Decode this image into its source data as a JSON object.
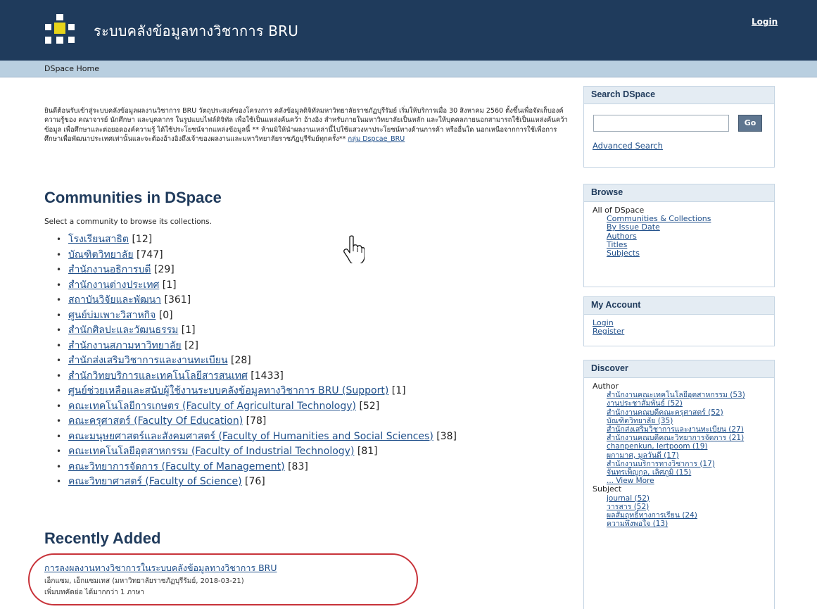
{
  "header": {
    "site_title": "ระบบคลังข้อมูลทางวิชาการ BRU",
    "login_label": "Login"
  },
  "breadcrumb": {
    "home": "DSpace Home"
  },
  "intro": {
    "text": "ยินดีต้อนรับเข้าสู่ระบบคลังข้อมูลผลงานวิชาการ BRU วัตถุประสงค์ของโครงการ คลังข้อมูลดิจิทัลมหาวิทยาลัยราชภัฏบุรีรัมย์ เริ่มให้บริการเมื่อ 30 สิงหาคม 2560 ตั้งขึ้นเพื่อจัดเก็บองค์ความรู้ของ คณาจารย์ นักศึกษา และบุคลากร ในรูปแบบไฟล์ดิจิทัล เพื่อใช้เป็นแหล่งค้นคว้า อ้างอิง สำหรับภายในมหาวิทยาลัยเป็นหลัก และให้บุคคลภายนอกสามารถใช้เป็นแหล่งค้นคว้าข้อมูล เพื่อศึกษาและต่อยอดองค์ความรู้ ได้ใช้ประโยชน์จากแหล่งข้อมูลนี้ ** ห้ามมิให้นำผลงานเหล่านี้ไปใช้แสวงหาประโยชน์ทางด้านการค้า หรืออื่นใด นอกเหนือจากการใช้เพื่อการศึกษาเพื่อพัฒนาประเทศเท่านั้นและจะต้องอ้างอิงถึงเจ้าของผลงานและมหาวิทยาลัยราชภัฏบุรีรัมย์ทุกครั้ง** ",
    "link": "กลุ่ม Dspcae_BRU"
  },
  "communities": {
    "heading": "Communities in DSpace",
    "hint": "Select a community to browse its collections.",
    "items": [
      {
        "name": "โรงเรียนสาธิต",
        "count": "[12]"
      },
      {
        "name": "บัณฑิตวิทยาลัย",
        "count": "[747]"
      },
      {
        "name": "สำนักงานอธิการบดี",
        "count": "[29]"
      },
      {
        "name": "สำนักงานต่างประเทศ",
        "count": "[1]"
      },
      {
        "name": "สถาบันวิจัยและพัฒนา",
        "count": "[361]"
      },
      {
        "name": "ศูนย์บ่มเพาะวิสาหกิจ",
        "count": "[0]"
      },
      {
        "name": "สำนักศิลปะและวัฒนธรรม",
        "count": "[1]"
      },
      {
        "name": "สำนักงานสภามหาวิทยาลัย",
        "count": "[2]"
      },
      {
        "name": "สำนักส่งเสริมวิชาการและงานทะเบียน",
        "count": "[28]"
      },
      {
        "name": "สำนักวิทยบริการและเทคโนโลยีสารสนเทศ",
        "count": "[1433]"
      },
      {
        "name": "ศูนย์ช่วยเหลือและสนับผู้ใช้งานระบบคลังข้อมูลทางวิชาการ BRU (Support)",
        "count": "[1]"
      },
      {
        "name": "คณะเทคโนโลยีการเกษตร (Faculty of Agricultural Technology)",
        "count": "[52]"
      },
      {
        "name": "คณะครุศาสตร์ (Faculty Of Education)",
        "count": "[78]"
      },
      {
        "name": "คณะมนุษยศาสตร์และสังคมศาสตร์ (Faculty of Humanities and Social Sciences)",
        "count": "[38]"
      },
      {
        "name": "คณะเทคโนโลยีอุตสาหกรรม (Faculty of Industrial Technology)",
        "count": "[81]"
      },
      {
        "name": "คณะวิทยาการจัดการ (Faculty of Management)",
        "count": "[83]"
      },
      {
        "name": "คณะวิทยาศาสตร์ (Faculty of Science)",
        "count": "[76]"
      }
    ]
  },
  "recent": {
    "heading": "Recently Added",
    "title": "การลงผลงานทางวิชาการในระบบคลังข้อมูลทางวิชาการ BRU",
    "meta": "เอ็กแซม, เอ็กแซมเทส (มหาวิทยาลัยราชภัฏบุรีรัมย์, 2018-03-21)",
    "abstract": "เพิ่มบทคัดย่อ ได้มากกว่า 1 ภาษา"
  },
  "search": {
    "heading": "Search DSpace",
    "go_label": "Go",
    "advanced": "Advanced Search"
  },
  "browse": {
    "heading": "Browse",
    "all_label": "All of DSpace",
    "links": [
      "Communities & Collections",
      "By Issue Date",
      "Authors",
      "Titles",
      "Subjects"
    ]
  },
  "account": {
    "heading": "My Account",
    "links": [
      "Login",
      "Register"
    ]
  },
  "discover": {
    "heading": "Discover",
    "author_label": "Author",
    "authors": [
      "สำนักงานคณะเทคโนโลยีอุตสาหกรรม (53)",
      "งานประชาสัมพันธ์ (52)",
      "สำนักงานคณบดีคณะครุศาสตร์ (52)",
      "บัณฑิตวิทยาลัย (35)",
      "สำนักส่งเสริมวิชาการและงานทะเบียน (27)",
      "สำนักงานคณบดีคณะวิทยาการจัดการ (21)",
      "chanpenkun, lertpoom (19)",
      "ผกามาศ, มูลวันดี (17)",
      "สำนักงานบริการทางวิชาการ (17)",
      "จันทรเพ็ญกุล, เลิศภูมิ (15)",
      "... View More"
    ],
    "subject_label": "Subject",
    "subjects": [
      "journal (52)",
      "วารสาร (52)",
      "ผลสัมฤทธิ์ทางการเรียน (24)",
      "ความพึงพอใจ (13)"
    ]
  },
  "colors": {
    "header_bg": "#1f3b5c",
    "crumb_bg": "#b9cfe0",
    "link": "#1f4f8a",
    "heading": "#203b5c",
    "highlight_ring": "#c8333a",
    "logo_yellow": "#e8d51a",
    "logo_white": "#ffffff"
  }
}
